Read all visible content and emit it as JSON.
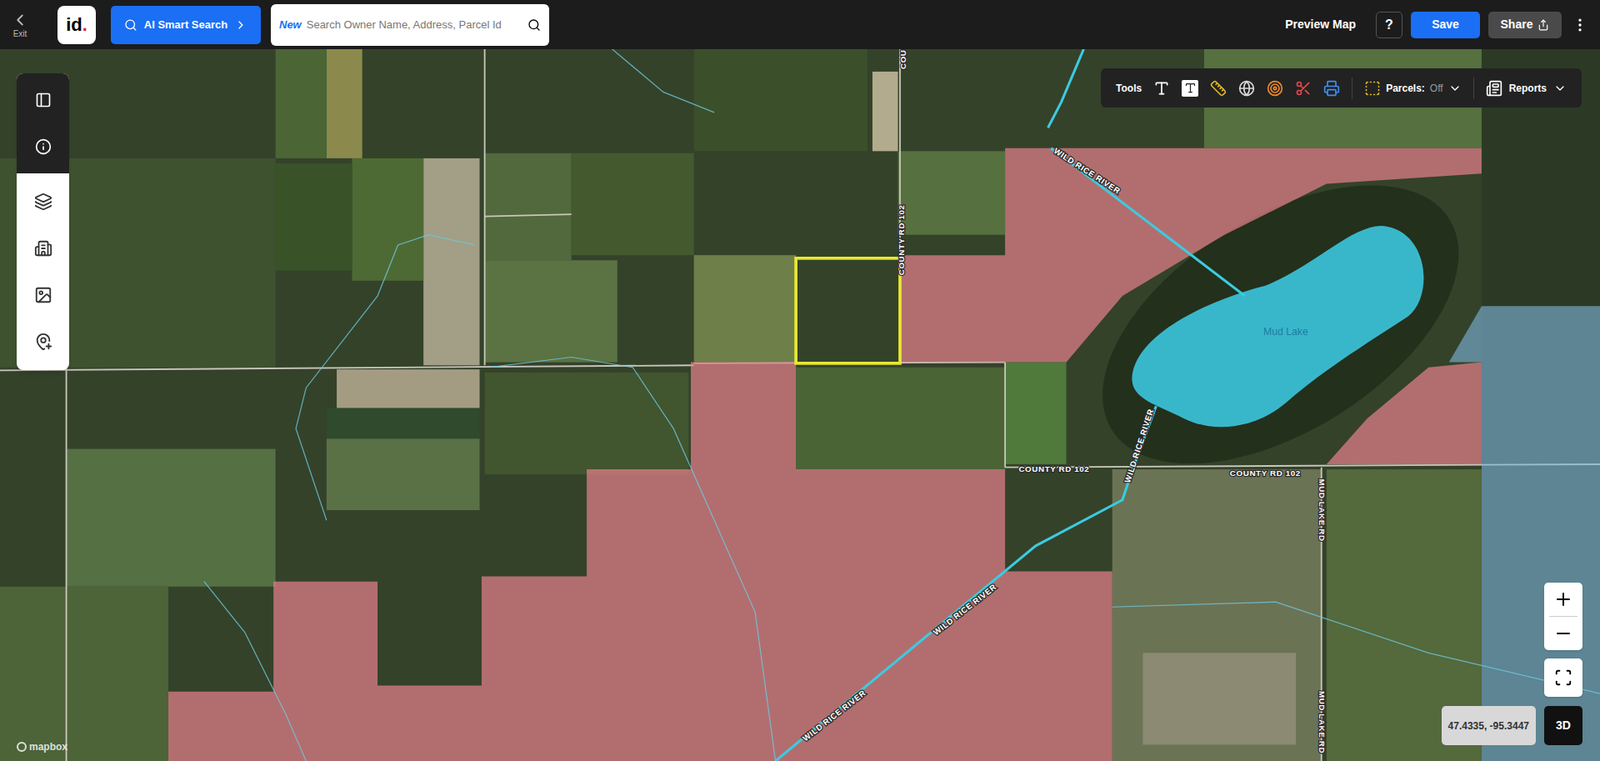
{
  "topbar": {
    "exit": {
      "label": "Exit"
    },
    "logo": {
      "text": "id",
      "dot": "."
    },
    "ai_search": {
      "label": "AI Smart Search"
    },
    "search": {
      "badge": "New",
      "placeholder": "Search Owner Name, Address, Parcel Id"
    },
    "preview": "Preview Map",
    "help": "?",
    "save": "Save",
    "share": "Share"
  },
  "tools": {
    "label": "Tools",
    "parcels": {
      "label": "Parcels:",
      "value": "Off"
    },
    "reports": "Reports"
  },
  "map": {
    "labels": [
      {
        "text": "WILD RICE RIVER",
        "kind": "river"
      },
      {
        "text": "WILD RICE RIVER",
        "kind": "river"
      },
      {
        "text": "WILD RICE RIVER",
        "kind": "river"
      },
      {
        "text": "WILD RICE RIVER",
        "kind": "river"
      },
      {
        "text": "Mud Lake",
        "kind": "lake"
      },
      {
        "text": "COUNTY RD 102",
        "kind": "road"
      },
      {
        "text": "COUNTY RD 102",
        "kind": "road"
      },
      {
        "text": "COUNTY RD 102",
        "kind": "road"
      },
      {
        "text": "COU",
        "kind": "road"
      },
      {
        "text": "MUD LAKE RD",
        "kind": "road"
      },
      {
        "text": "MUD LAKE RD",
        "kind": "road"
      }
    ],
    "coordinates": "47.4335, -95.3447",
    "view_3d": "3D",
    "attribution": "mapbox"
  }
}
